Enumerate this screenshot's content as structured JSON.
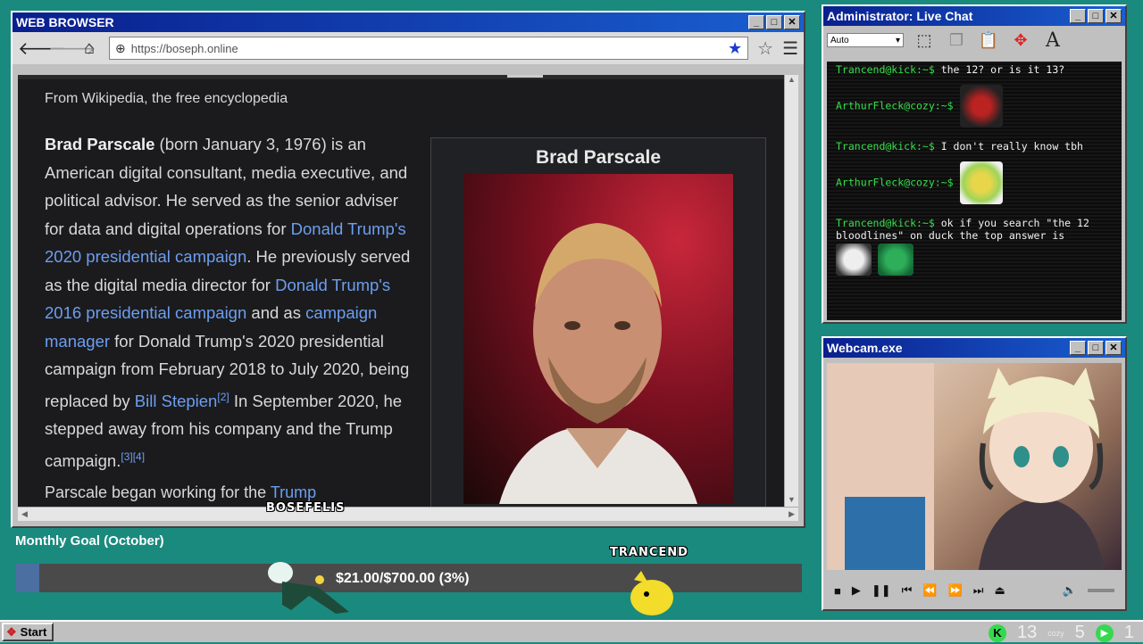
{
  "browser": {
    "title": "WEB BROWSER",
    "url": "https://boseph.online",
    "page": {
      "tagline": "From Wikipedia, the free encyclopedia",
      "infobox_title": "Brad Parscale",
      "para1": {
        "name": "Brad Parscale",
        "t1": " (born January 3, 1976) is an American digital consultant, media executive, and political advisor. He served as the senior adviser for data and digital operations for ",
        "link1": "Donald Trump's 2020 presidential campaign",
        "t2": ". He previously served as the digital media director for ",
        "link2": "Donald Trump's 2016 presidential campaign",
        "t3": " and as ",
        "link3": "campaign manager",
        "t4": " for Donald Trump's 2020 presidential campaign from February 2018 to July 2020, being replaced by ",
        "link4": "Bill Stepien",
        "ref1": "[2]",
        "t5": " In September 2020, he stepped away from his company and the Trump campaign.",
        "ref2": "[3][4]"
      },
      "para2_start": "Parscale began working for the ",
      "para2_link": "Trump"
    }
  },
  "chat": {
    "title": "Administrator: Live Chat",
    "select_value": "Auto",
    "messages": [
      {
        "user": "Trancend@kick:~$",
        "text": " the 12? or is it 13?"
      },
      {
        "user": "ArthurFleck@cozy:~$",
        "text": ""
      },
      {
        "user": "Trancend@kick:~$",
        "text": " I don't really know tbh"
      },
      {
        "user": "ArthurFleck@cozy:~$",
        "text": ""
      },
      {
        "user": "Trancend@kick:~$",
        "text": " ok if you search \"the 12 bloodlines\" on duck the top answer is"
      }
    ]
  },
  "webcam": {
    "title": "Webcam.exe"
  },
  "goal": {
    "label": "Monthly Goal (October)",
    "amount_text": "$21.00/$700.00 (3%)",
    "fraction": 0.03
  },
  "sprites": {
    "left_name": "BOSEFELIS",
    "right_name": "TRANCEND"
  },
  "taskbar": {
    "start_label": "Start",
    "kick_count": "13",
    "cozy_label": "cozy",
    "cozy_count": "5",
    "play_count": "1"
  }
}
